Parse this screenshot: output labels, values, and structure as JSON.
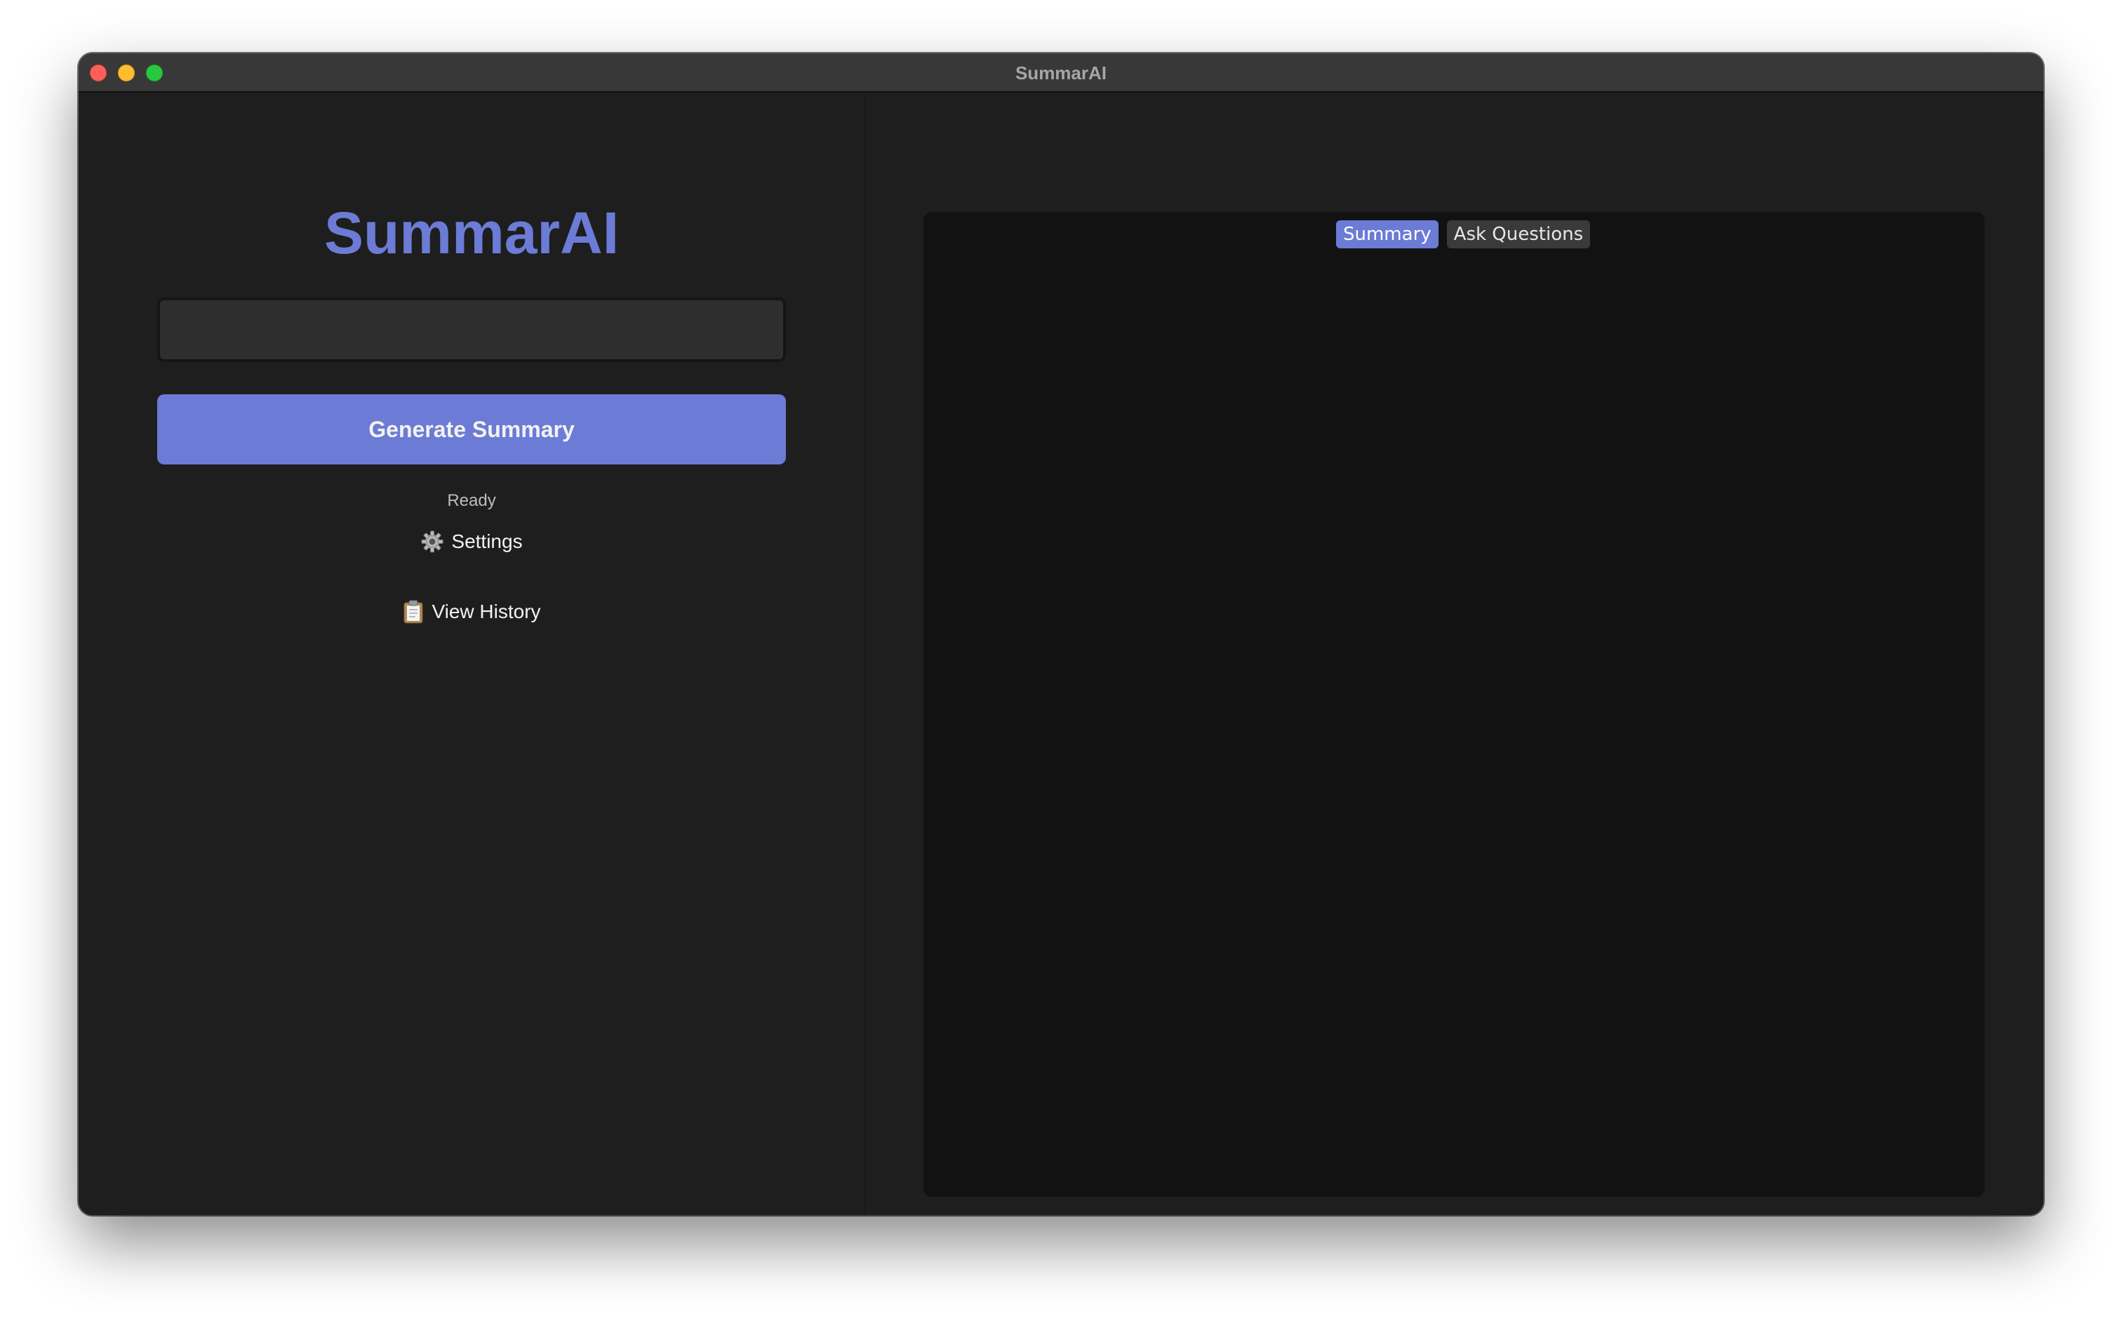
{
  "window": {
    "title": "SummarAI"
  },
  "sidebar": {
    "heading": "SummarAI",
    "input": {
      "value": "",
      "placeholder": ""
    },
    "generate_label": "Generate Summary",
    "status": "Ready",
    "settings_label": "Settings",
    "settings_icon": "gear-icon",
    "history_label": "View History",
    "history_icon": "clipboard-icon"
  },
  "main": {
    "tabs": [
      {
        "label": "Summary",
        "active": true
      },
      {
        "label": "Ask Questions",
        "active": false
      }
    ],
    "summary_text": ""
  },
  "colors": {
    "accent": "#6c7bd5",
    "background": "#1e1e1e",
    "panel": "#121212"
  }
}
